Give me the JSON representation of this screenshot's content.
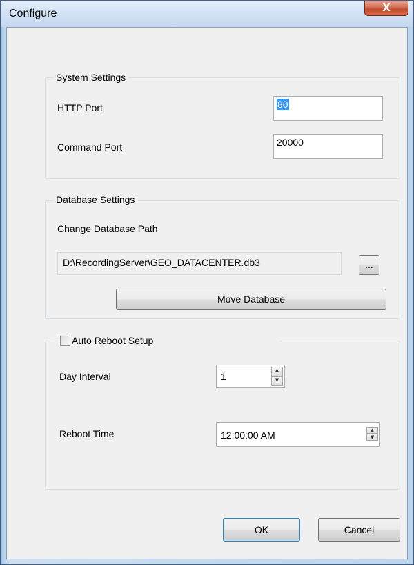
{
  "window": {
    "title": "Configure",
    "close_glyph": "X"
  },
  "system_settings": {
    "legend": "System Settings",
    "http_port_label": "HTTP Port",
    "http_port_value": "80",
    "command_port_label": "Command Port",
    "command_port_value": "20000"
  },
  "database_settings": {
    "legend": "Database Settings",
    "change_path_label": "Change Database Path",
    "path_value": "D:\\RecordingServer\\GEO_DATACENTER.db3",
    "browse_label": "...",
    "move_label": "Move Database"
  },
  "auto_reboot": {
    "legend": "Auto Reboot Setup",
    "checked": false,
    "day_interval_label": "Day Interval",
    "day_interval_value": "1",
    "reboot_time_label": "Reboot Time",
    "reboot_time_value": "12:00:00 AM"
  },
  "footer": {
    "ok_label": "OK",
    "cancel_label": "Cancel"
  },
  "icons": {
    "up_arrow": "▲",
    "down_arrow": "▼"
  },
  "colors": {
    "selection": "#3399ff",
    "close_button": "#c24a2c",
    "frame": "#bcd5ee"
  }
}
